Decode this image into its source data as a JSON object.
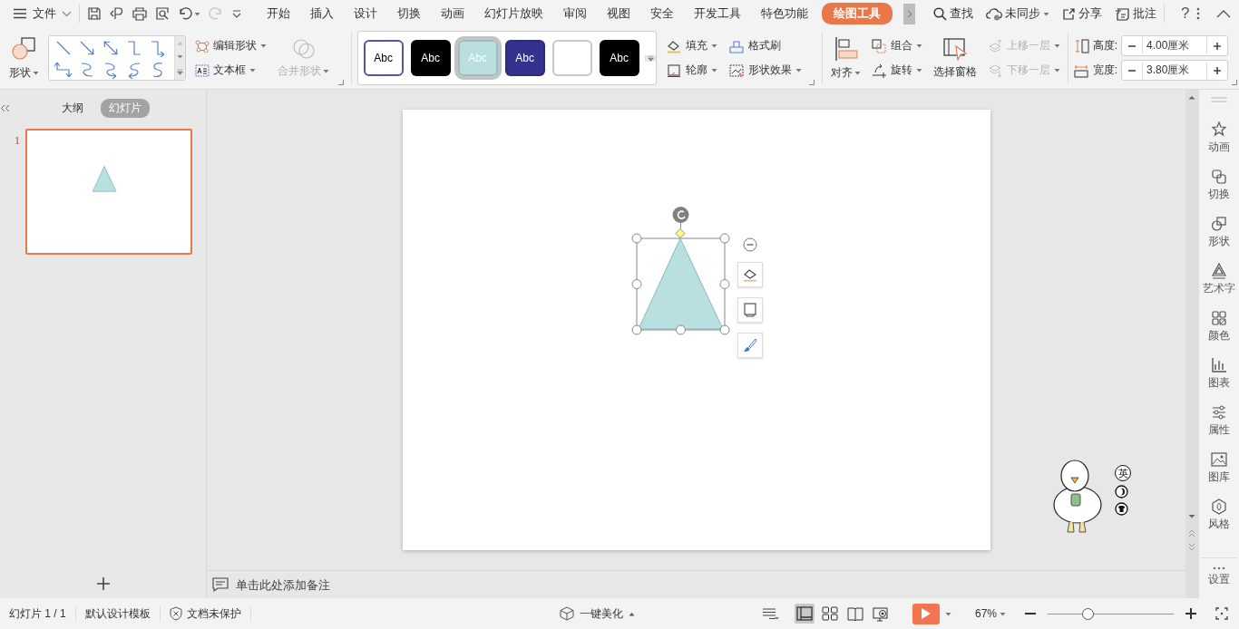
{
  "menu": {
    "label": "文件"
  },
  "tabs": [
    {
      "label": "开始",
      "selected": false
    },
    {
      "label": "插入",
      "selected": false
    },
    {
      "label": "设计",
      "selected": false
    },
    {
      "label": "切换",
      "selected": false
    },
    {
      "label": "动画",
      "selected": false
    },
    {
      "label": "幻灯片放映",
      "selected": false
    },
    {
      "label": "审阅",
      "selected": false
    },
    {
      "label": "视图",
      "selected": false
    },
    {
      "label": "安全",
      "selected": false
    },
    {
      "label": "开发工具",
      "selected": false
    },
    {
      "label": "特色功能",
      "selected": false
    },
    {
      "label": "绘图工具",
      "selected": true
    }
  ],
  "top_actions": [
    {
      "kind": "search",
      "label": "查找"
    },
    {
      "kind": "sync",
      "label": "未同步"
    },
    {
      "kind": "share",
      "label": "分享"
    },
    {
      "kind": "comment",
      "label": "批注"
    }
  ],
  "help": "?",
  "ribbon": {
    "shape": "形状",
    "edit_shape": "编辑形状",
    "text_box": "文本框",
    "merge_shape": {
      "label": "合并形状",
      "disabled": true
    },
    "styles": [
      {
        "label": "Abc",
        "color": "#ffffff",
        "selected": false
      },
      {
        "label": "Abc",
        "color": "#000000",
        "selected": false
      },
      {
        "label": "Abc",
        "color": "#b9dfe1",
        "selected": true
      },
      {
        "label": "Abc",
        "color": "#33338f",
        "selected": false
      },
      {
        "color": "#ffffff",
        "selected": false
      },
      {
        "label": "Abc",
        "color": "#000000",
        "selected": false
      }
    ],
    "fill": "填充",
    "format_painter": "格式刷",
    "outline": "轮廓",
    "shape_effects": "形状效果",
    "align": "对齐",
    "group": "组合",
    "rotate": "旋转",
    "selection_pane": "选择窗格",
    "bring_forward": {
      "label": "上移一层",
      "disabled": true
    },
    "send_backward": {
      "label": "下移一层",
      "disabled": true
    },
    "height": {
      "label": "高度:",
      "value": "4.00厘米"
    },
    "width": {
      "label": "宽度:",
      "value": "3.80厘米"
    }
  },
  "left_panel": {
    "tabs": [
      {
        "label": "大纲",
        "selected": false
      },
      {
        "label": "幻灯片",
        "selected": true
      }
    ]
  },
  "slides": [
    {
      "number": "1",
      "selected": true,
      "shape": {
        "kind": "triangle",
        "selected": true
      }
    }
  ],
  "notes": {
    "placeholder": "单击此处添加备注"
  },
  "right_sidebar": [
    {
      "kind": "animation",
      "label": "动画"
    },
    {
      "kind": "transition",
      "label": "切换"
    },
    {
      "kind": "shape",
      "label": "形状"
    },
    {
      "kind": "wordart",
      "label": "艺术字"
    },
    {
      "kind": "color",
      "label": "颜色"
    },
    {
      "kind": "chart",
      "label": "图表"
    },
    {
      "kind": "properties",
      "label": "属性"
    },
    {
      "kind": "gallery",
      "label": "图库"
    },
    {
      "kind": "style",
      "label": "风格"
    },
    {
      "kind": "settings",
      "label": "设置"
    }
  ],
  "ime_toolbar": {
    "mode": "英"
  },
  "status_bar": {
    "slide_info": "幻灯片 1 / 1",
    "template": "默认设计模板",
    "protection": "文档未保护",
    "beautify": "一键美化",
    "views": [
      {
        "kind": "normal",
        "selected": true
      },
      {
        "kind": "sorter",
        "selected": false
      },
      {
        "kind": "reading",
        "selected": false
      },
      {
        "kind": "presenter",
        "selected": false
      }
    ],
    "zoom": "67%",
    "zoom_slider": {
      "level": 0.32
    }
  }
}
